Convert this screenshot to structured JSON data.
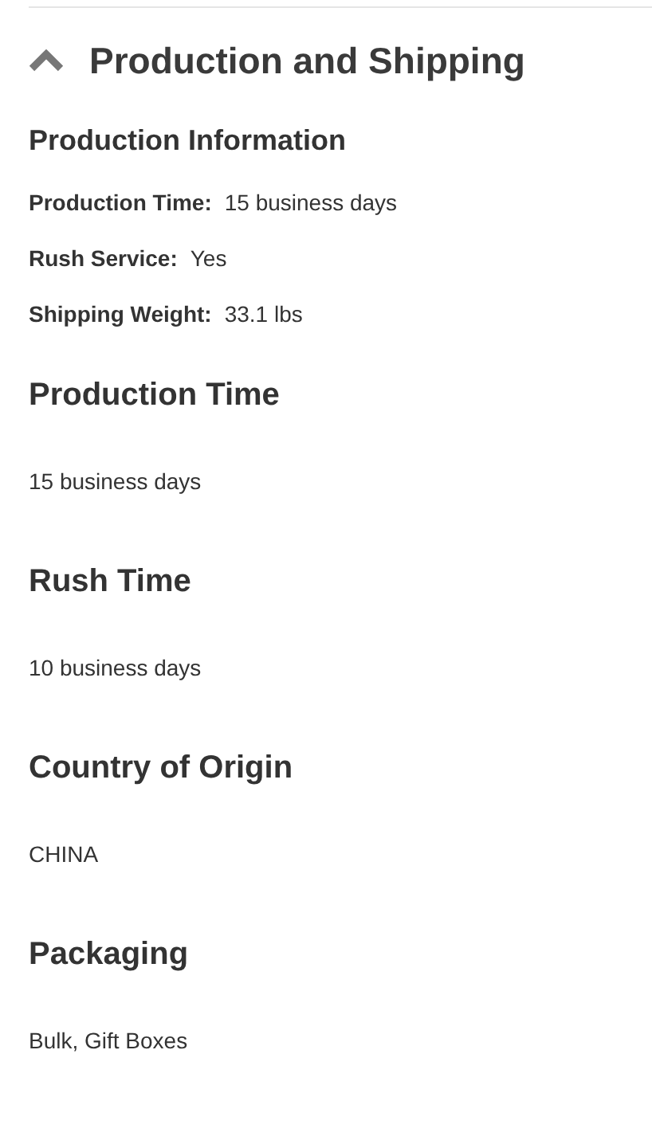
{
  "section": {
    "title": "Production and Shipping",
    "expanded": true
  },
  "info": {
    "title": "Production Information",
    "rows": [
      {
        "label": "Production Time:",
        "value": "15 business days"
      },
      {
        "label": "Rush Service:",
        "value": "Yes"
      },
      {
        "label": "Shipping Weight:",
        "value": "33.1 lbs"
      }
    ]
  },
  "details": [
    {
      "heading": "Production Time",
      "value": "15 business days"
    },
    {
      "heading": "Rush Time",
      "value": "10 business days"
    },
    {
      "heading": "Country of Origin",
      "value": "CHINA"
    },
    {
      "heading": "Packaging",
      "value": "Bulk, Gift Boxes"
    }
  ]
}
